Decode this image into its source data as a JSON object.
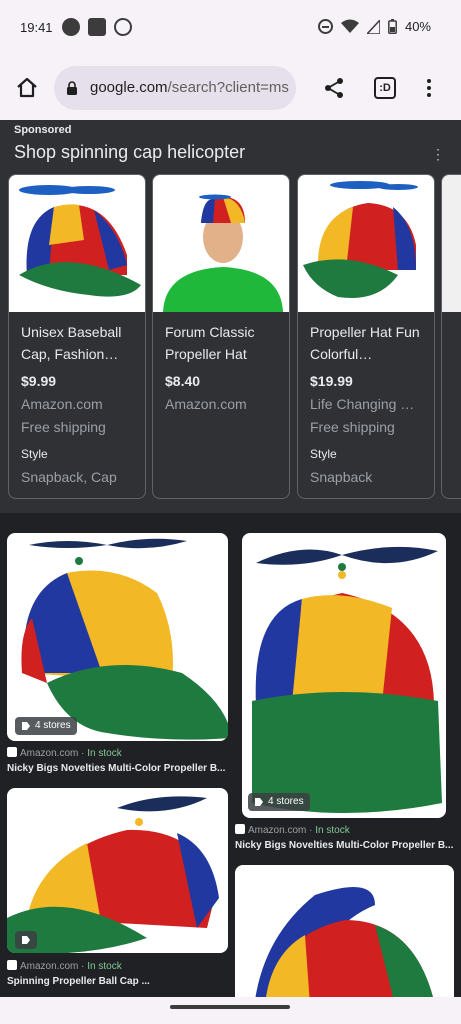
{
  "status_bar": {
    "time": "19:41",
    "battery": "40%"
  },
  "toolbar": {
    "url_domain": "google.com",
    "url_rest": "/search?client=ms",
    "tab_count": ":D"
  },
  "shopping": {
    "sponsored_label": "Sponsored",
    "title": "Shop spinning cap helicopter",
    "products": [
      {
        "title": "Unisex Baseball Cap, Fashion…",
        "price": "$9.99",
        "store": "Amazon.com",
        "shipping": "Free shipping",
        "style_label": "Style",
        "style_value": "Snapback, Cap"
      },
      {
        "title": "Forum Classic Propeller Hat",
        "price": "$8.40",
        "store": "Amazon.com"
      },
      {
        "title": "Propeller Hat Fun Colorful…",
        "price": "$19.99",
        "store": "Life Changing …",
        "shipping": "Free shipping",
        "style_label": "Style",
        "style_value": "Snapback"
      }
    ]
  },
  "images": [
    {
      "stores": "4 stores",
      "source": "Amazon.com",
      "stock": "In stock",
      "title": "Nicky Bigs Novelties Multi-Color Propeller B..."
    },
    {
      "stores": "4 stores",
      "source": "Amazon.com",
      "stock": "In stock",
      "title": "Nicky Bigs Novelties Multi-Color Propeller B..."
    },
    {
      "source": "Amazon.com",
      "stock": "In stock",
      "title": "Spinning Propeller Ball Cap ..."
    }
  ]
}
